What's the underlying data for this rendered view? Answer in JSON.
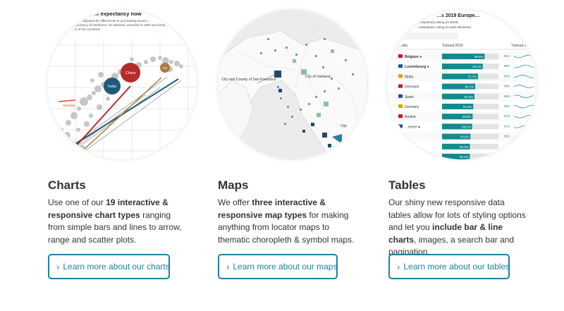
{
  "cards": [
    {
      "title": "Charts",
      "desc_parts": [
        "Use one of our ",
        "19 interactive & responsive chart types",
        " ranging from simple bars and lines to arrow, range and scatter plots."
      ],
      "button_label": "Learn more about our charts",
      "button_icon": "chevron-right-icon",
      "preview": {
        "heading": "…er life expectancy now",
        "subtitle_lines": [
          "…ation adjusted for differences in purchasing power (…",
          "…expectancy of newborns, for selected countries in 1800 and 2015.",
          "…in of the countries."
        ],
        "labels": [
          "China",
          "India",
          "US",
          "Somalia"
        ],
        "colors": {
          "china": "#b52a2a",
          "india": "#1e5a7a",
          "us": "#a87b3e",
          "somalia": "#d04a1a"
        }
      }
    },
    {
      "title": "Maps",
      "desc_parts": [
        "We offer ",
        "three interactive & responsive map types",
        " for making anything from locator maps to thematic choropleth & symbol maps."
      ],
      "button_label": "Learn more about our maps",
      "button_icon": "chevron-right-icon",
      "preview": {
        "labels": [
          "City and County of San Francisco",
          "City of Oakland",
          "City"
        ],
        "colors": {
          "water": "#ececec",
          "land": "#fafafa",
          "symbol_dark": "#1e4a6e",
          "symbol_light": "#8fbfa0"
        }
      }
    },
    {
      "title": "Tables",
      "desc_parts": [
        "Our shiny new responsive data tables allow for lots of styling options and let you ",
        "include bar & line charts",
        ", images, a search bar and pagination."
      ],
      "button_label": "Learn more about our tables",
      "button_icon": "chevron-right-icon",
      "preview": {
        "heading": "…s 2019 Europe…",
        "legend": [
          "…compulsory voting (in 2019)",
          "…compulsory voting (in past elections)"
        ],
        "columns": [
          "…ntry",
          "Turnout 2019",
          "Turnout 1…"
        ],
        "rows": [
          {
            "country": "Belgium ●",
            "value": "88.5%",
            "trend": "91%"
          },
          {
            "country": "Luxembourg ●",
            "value": "84.1%",
            "trend": "89%"
          },
          {
            "country": "Malta",
            "value": "72.7%",
            "trend": "82%"
          },
          {
            "country": "Denmark",
            "value": "66.1%",
            "trend": "48%"
          },
          {
            "country": "Spain",
            "value": "64.3%",
            "trend": "58%"
          },
          {
            "country": "Germany",
            "value": "61.4%",
            "trend": "65%"
          },
          {
            "country": "Austria",
            "value": "59.8%",
            "trend": "61%"
          },
          {
            "country": "…reece ●",
            "value": "58.5%",
            "trend": "51%"
          },
          {
            "country": "",
            "value": "54.6%",
            "trend": "56%"
          },
          {
            "country": "",
            "value": "53.3%",
            "trend": ""
          },
          {
            "country": "",
            "value": "53.1%",
            "trend": ""
          }
        ],
        "colors": {
          "bar": "#138a8e",
          "bar_bg": "#e3e3e3"
        }
      }
    }
  ],
  "theme": {
    "accent": "#1d81a2",
    "text": "#333333"
  }
}
